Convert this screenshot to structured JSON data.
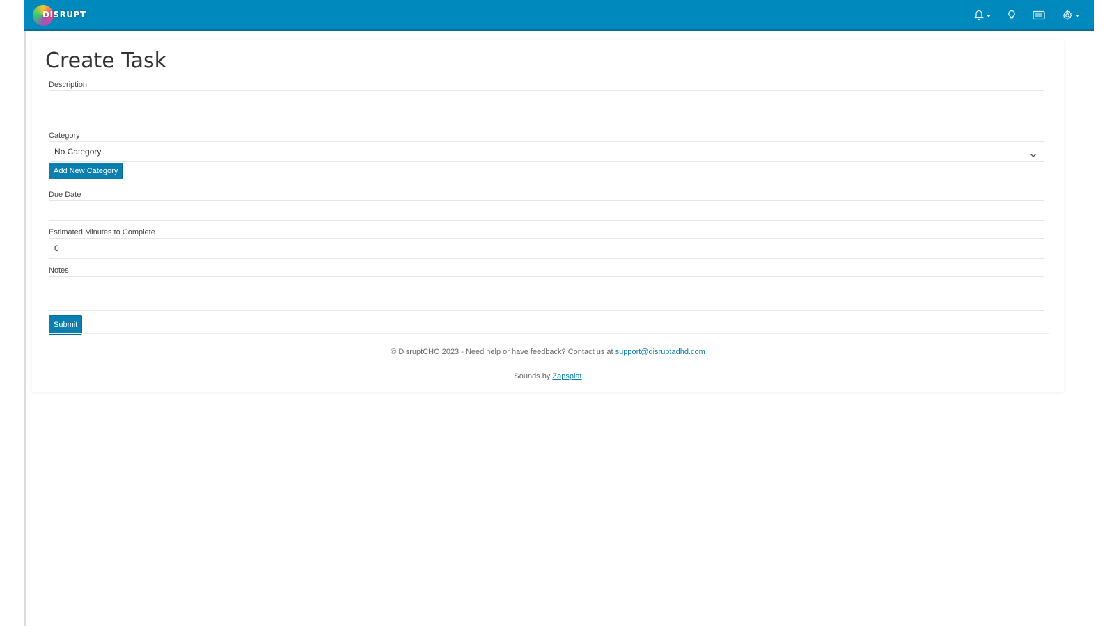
{
  "app": {
    "brand_name": "DISRUPT",
    "colors": {
      "navbar": "#0089bd",
      "button": "#0a7fb0"
    }
  },
  "navbar": {
    "icons": [
      "bell-icon",
      "lightbulb-icon",
      "message-icon",
      "gear-icon"
    ]
  },
  "page": {
    "title": "Create Task"
  },
  "form": {
    "description": {
      "label": "Description",
      "value": ""
    },
    "category": {
      "label": "Category",
      "selected": "No Category"
    },
    "add_category_label": "Add New Category",
    "due_date": {
      "label": "Due Date",
      "value": ""
    },
    "estimated_minutes": {
      "label": "Estimated Minutes to Complete",
      "value": "0"
    },
    "notes": {
      "label": "Notes",
      "value": ""
    },
    "submit_label": "Submit"
  },
  "footer": {
    "line1_text": "© DisruptCHO 2023 - Need help or have feedback? Contact us at",
    "email": "support@disruptadhd.com",
    "line2_text": "Sounds by",
    "sounds_link": "Zapsplat"
  }
}
